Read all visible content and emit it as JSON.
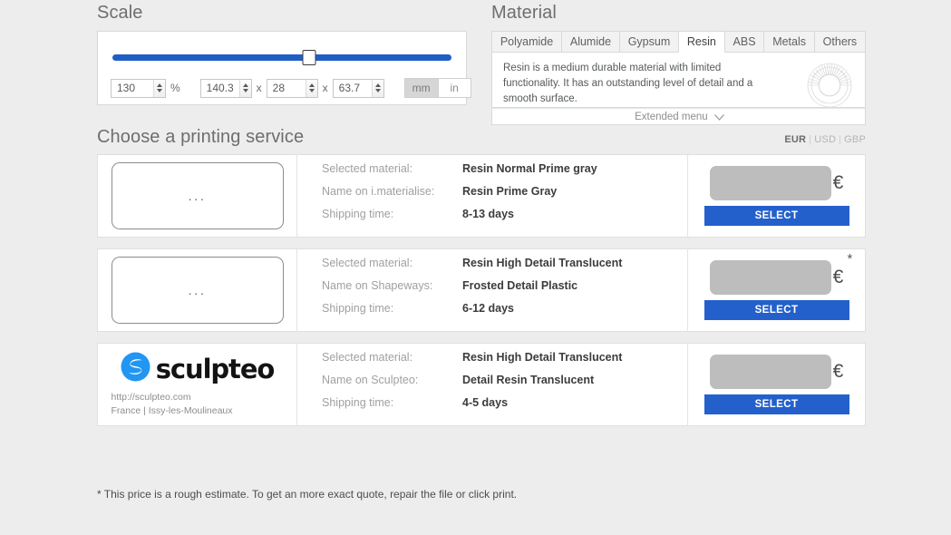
{
  "scale": {
    "title": "Scale",
    "slider": {
      "name": "scale-slider",
      "value_percent": 58
    },
    "percent_input": {
      "value": "130",
      "placeholder": ""
    },
    "percent_label": "%",
    "dim_x": {
      "value": "140.3",
      "placeholder": ""
    },
    "dim_y": {
      "value": "28",
      "placeholder": ""
    },
    "dim_z": {
      "value": "63.7",
      "placeholder": ""
    },
    "multiply_symbol": "x",
    "units": {
      "mm": "mm",
      "in": "in",
      "selected": "mm"
    }
  },
  "material": {
    "title": "Material",
    "tabs": [
      {
        "label": "Polyamide",
        "active": false
      },
      {
        "label": "Alumide",
        "active": false
      },
      {
        "label": "Gypsum",
        "active": false
      },
      {
        "label": "Resin",
        "active": true
      },
      {
        "label": "ABS",
        "active": false
      },
      {
        "label": "Metals",
        "active": false
      },
      {
        "label": "Others",
        "active": false
      }
    ],
    "description": "Resin is a medium durable material with limited functionality. It has an outstanding level of detail and a smooth surface.",
    "extended_menu": "Extended menu"
  },
  "services": {
    "title": "Choose a printing service",
    "currencies": [
      {
        "code": "EUR",
        "active": true
      },
      {
        "code": "USD",
        "active": false
      },
      {
        "code": "GBP",
        "active": false
      }
    ],
    "currency_symbol": "€",
    "select_label": "SELECT",
    "loading_dots": "...",
    "cards": [
      {
        "logo_type": "placeholder",
        "logo_text": "",
        "url": "",
        "location": "",
        "rows": [
          {
            "label": "Selected material:",
            "value": "Resin Normal Prime gray"
          },
          {
            "label": "Name on i.materialise:",
            "value": "Resin Prime Gray"
          },
          {
            "label": "Shipping time:",
            "value": "8-13 days"
          }
        ],
        "price": "",
        "estimate_marker": ""
      },
      {
        "logo_type": "placeholder",
        "logo_text": "",
        "url": "",
        "location": "",
        "rows": [
          {
            "label": "Selected material:",
            "value": "Resin High Detail Translucent"
          },
          {
            "label": "Name on Shapeways:",
            "value": "Frosted Detail Plastic"
          },
          {
            "label": "Shipping time:",
            "value": "6-12 days"
          }
        ],
        "price": "",
        "estimate_marker": "*"
      },
      {
        "logo_type": "sculpteo",
        "logo_text": "sculpteo",
        "url": "http://sculpteo.com",
        "location": "France | Issy-les-Moulineaux",
        "rows": [
          {
            "label": "Selected material:",
            "value": "Resin High Detail Translucent"
          },
          {
            "label": "Name on Sculpteo:",
            "value": "Detail Resin Translucent"
          },
          {
            "label": "Shipping time:",
            "value": "4-5 days"
          }
        ],
        "price": "",
        "estimate_marker": ""
      }
    ]
  },
  "footnote": "* This price is a rough estimate. To get an more exact quote, repair the file or click print.",
  "colors": {
    "accent_blue": "#2360cc",
    "slider_blue": "#1f5fc4",
    "page_background": "#ededed",
    "logo_blue": "#2196f3"
  }
}
